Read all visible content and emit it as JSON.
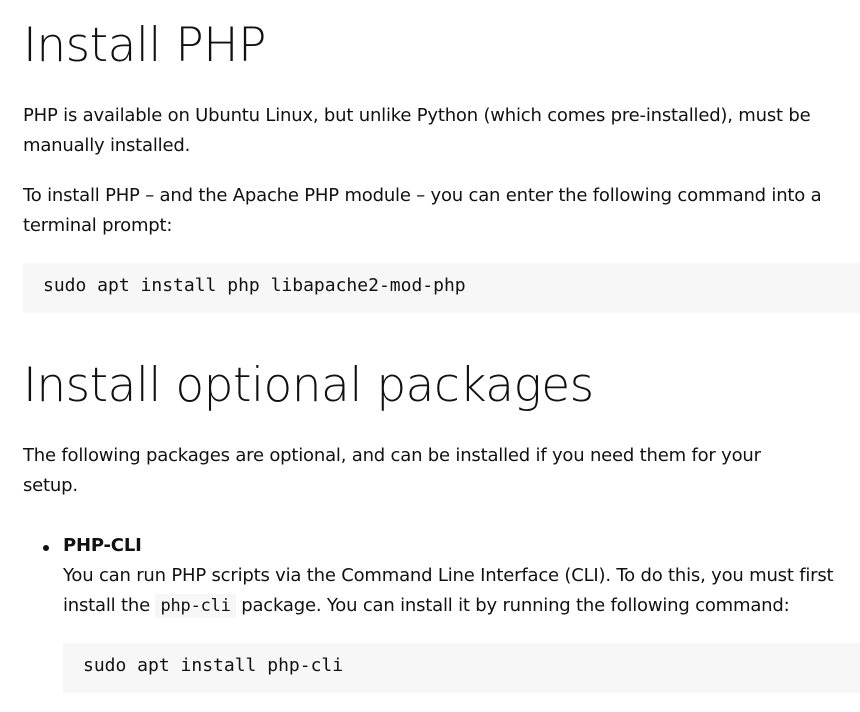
{
  "section1": {
    "heading": "Install PHP",
    "para1": "PHP is available on Ubuntu Linux, but unlike Python (which comes pre-installed), must be manually installed.",
    "para2": "To install PHP – and the Apache PHP module – you can enter the following command into a terminal prompt:",
    "code": "sudo apt install php libapache2-mod-php"
  },
  "section2": {
    "heading": "Install optional packages",
    "para1": "The following packages are optional, and can be installed if you need them for your setup.",
    "items": [
      {
        "title": "PHP-CLI",
        "desc_before": "You can run PHP scripts via the Command Line Interface (CLI). To do this, you must first install the ",
        "desc_code": "php-cli",
        "desc_after": " package. You can install it by running the following command:",
        "code": "sudo apt install php-cli"
      }
    ]
  }
}
